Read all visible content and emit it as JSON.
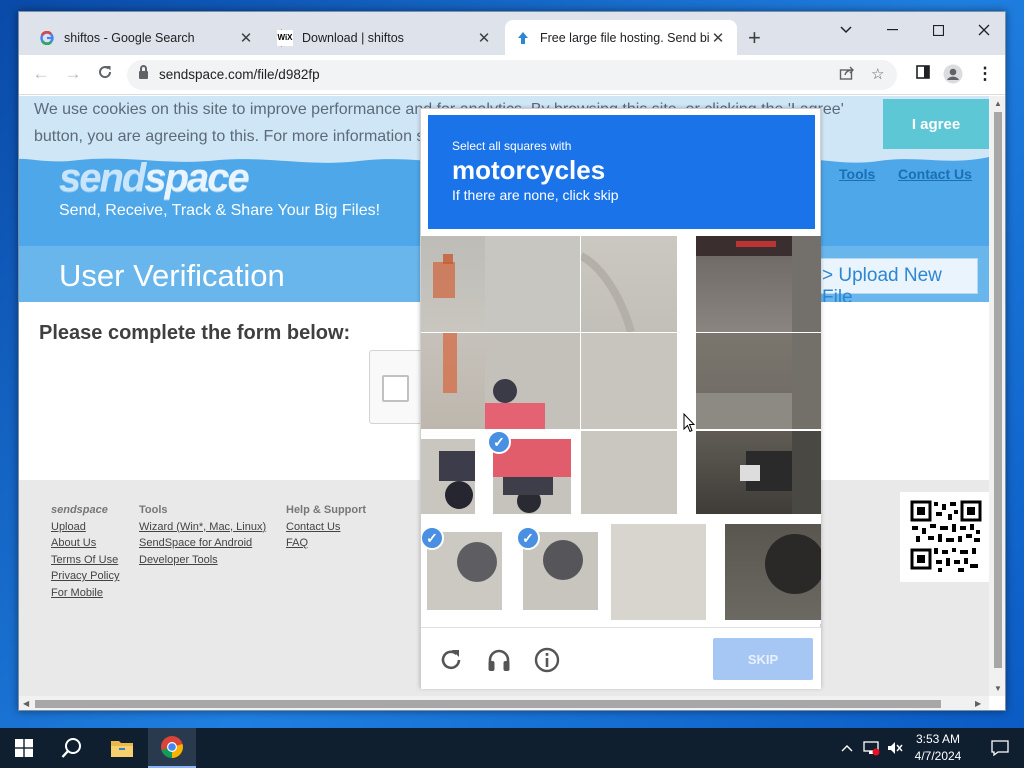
{
  "browser": {
    "tabs": [
      {
        "title": "shiftos - Google Search",
        "favicon": "google-icon",
        "active": false
      },
      {
        "title": "Download | shiftos",
        "favicon": "wix-icon",
        "active": false
      },
      {
        "title": "Free large file hosting. Send big",
        "favicon": "sendspace-icon",
        "active": true
      }
    ],
    "url": "sendspace.com/file/d982fp"
  },
  "cookie": {
    "line1": "We use cookies on this site to improve performance and for analytics. By browsing this site, or clicking the 'I agree'",
    "line2": "button, you are agreeing to this. For more information s",
    "agree_label": "I agree"
  },
  "header": {
    "logo_send": "send",
    "logo_space": "space",
    "tagline": "Send, Receive, Track & Share Your Big Files!",
    "nav_tools": "Tools",
    "nav_contact": "Contact Us",
    "page_heading": "User Verification",
    "upload_new": "> Upload New File"
  },
  "content": {
    "form_prompt": "Please complete the form below:"
  },
  "footer": {
    "col1": {
      "heading": "sendspace",
      "links": [
        "Upload",
        "About Us",
        "Terms Of Use",
        "Privacy Policy",
        "For Mobile"
      ]
    },
    "col2": {
      "heading": "Tools",
      "links": [
        "Wizard (Win*, Mac, Linux)",
        "SendSpace for Android",
        "Developer Tools"
      ]
    },
    "col3": {
      "heading": "Help & Support",
      "links": [
        "Contact Us",
        "FAQ"
      ]
    }
  },
  "captcha": {
    "instruction_small": "Select all squares with",
    "target": "motorcycles",
    "instruction_hint": "If there are none, click skip",
    "skip_label": "SKIP",
    "accent_color": "#1a73e8"
  },
  "taskbar": {
    "time": "3:53 AM",
    "date": "4/7/2024"
  }
}
